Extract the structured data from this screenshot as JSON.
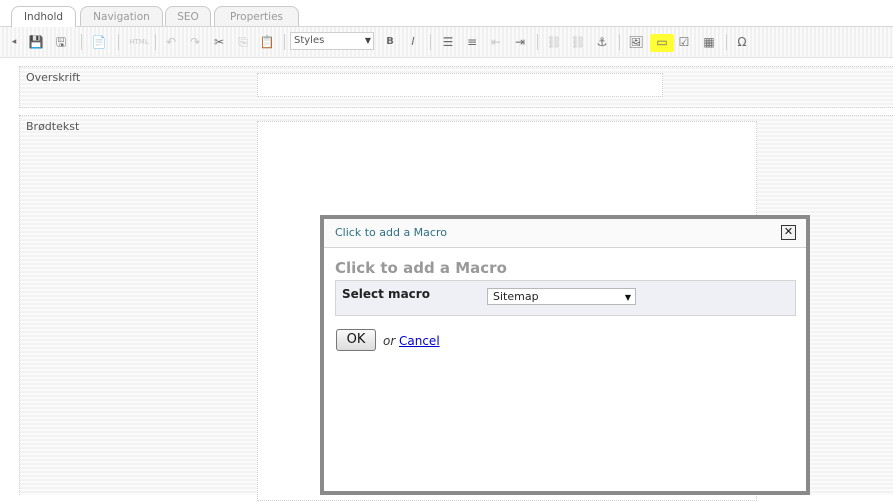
{
  "tabs": [
    {
      "label": "Indhold",
      "active": true
    },
    {
      "label": "Navigation",
      "active": false
    },
    {
      "label": "SEO",
      "active": false
    },
    {
      "label": "Properties",
      "active": false
    }
  ],
  "toolbar": {
    "styles_select": "Styles",
    "macro_highlight_color": "#ffff33"
  },
  "fields": {
    "overskrift_label": "Overskrift",
    "overskrift_value": "",
    "brodtekst_label": "Brødtekst"
  },
  "modal": {
    "title": "Click to add a Macro",
    "heading": "Click to add a Macro",
    "close_glyph": "✕",
    "select_label": "Select macro",
    "selected_macro": "Sitemap",
    "ok_label": "OK",
    "or_text": "or",
    "cancel_label": "Cancel"
  },
  "icons": {
    "toolbar_left_arrow": "◂",
    "save": "💾",
    "save_publish": "🖫",
    "preview": "📄",
    "html": "HTML",
    "undo": "↶",
    "redo": "↷",
    "cut": "✂",
    "copy": "⎘",
    "paste": "📋",
    "dropdown": "▼",
    "bold": "B",
    "italic": "I",
    "bullet_list": "☰",
    "numbered_list": "≡",
    "outdent": "⇤",
    "indent": "⇥",
    "link": "⛓",
    "unlink": "⛓",
    "anchor": "⚓",
    "image": "🖼",
    "macro": "▭",
    "form": "☑",
    "table": "▦",
    "special_char": "Ω"
  }
}
